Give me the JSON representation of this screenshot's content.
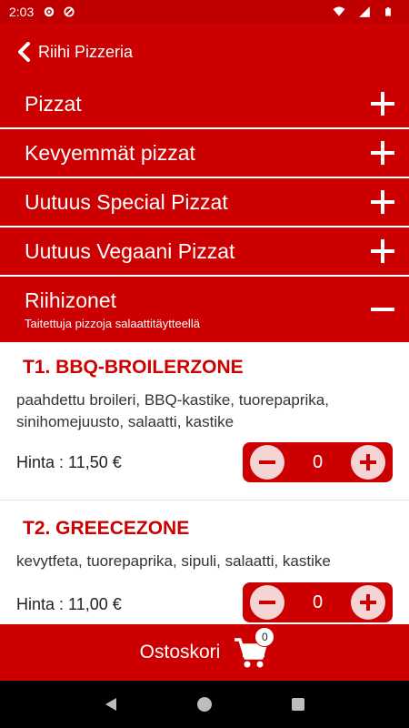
{
  "status_bar": {
    "time": "2:03"
  },
  "header": {
    "title": "Riihi Pizzeria"
  },
  "categories": [
    {
      "label": "Pizzat",
      "state": "collapsed"
    },
    {
      "label": "Kevyemmät pizzat",
      "state": "collapsed"
    },
    {
      "label": "Uutuus Special Pizzat",
      "state": "collapsed"
    },
    {
      "label": "Uutuus Vegaani Pizzat",
      "state": "collapsed"
    },
    {
      "label": "Riihizonet",
      "subtitle": "Taitettuja pizzoja salaattitäytteellä",
      "state": "expanded"
    }
  ],
  "products": [
    {
      "name": "T1. BBQ-BROILERZONE",
      "description": "paahdettu broileri, BBQ-kastike, tuorepaprika, sinihomejuusto, salaatti, kastike",
      "price": "Hinta : 11,50 €",
      "quantity": "0"
    },
    {
      "name": "T2. GREECEZONE",
      "description": "kevytfeta, tuorepaprika, sipuli, salaatti, kastike",
      "price": "Hinta : 11,00 €",
      "quantity": "0"
    }
  ],
  "cart": {
    "label": "Ostoskori",
    "count": "0"
  },
  "colors": {
    "primary": "#cc0000",
    "status_bar": "#c00000",
    "stepper_button": "#f4d4d4",
    "nav_bar": "#000000"
  },
  "icons": [
    "settings-icon",
    "sync-icon",
    "wifi-icon",
    "signal-icon",
    "battery-icon",
    "back-chevron-icon",
    "plus-icon",
    "minus-icon",
    "cart-icon",
    "nav-back-icon",
    "nav-home-icon",
    "nav-recents-icon"
  ]
}
